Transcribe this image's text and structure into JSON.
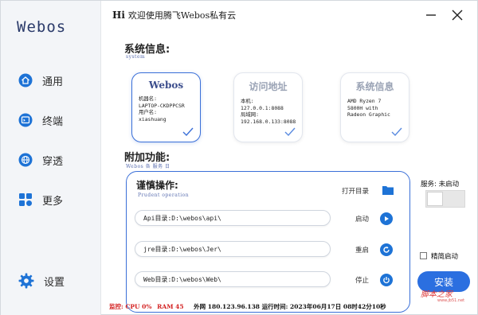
{
  "app": {
    "logo": "Webos"
  },
  "titlebar": {
    "greeting": "Hi",
    "title": "欢迎使用腾飞Webos私有云"
  },
  "sidebar": {
    "items": [
      {
        "label": "通用",
        "icon": "home-icon"
      },
      {
        "label": "终端",
        "icon": "terminal-icon"
      },
      {
        "label": "穿透",
        "icon": "globe-icon"
      },
      {
        "label": "更多",
        "icon": "grid-icon"
      }
    ],
    "settings": {
      "label": "设置",
      "icon": "gear-icon"
    }
  },
  "system": {
    "title": "系统信息:",
    "subtitle": "system",
    "cards": [
      {
        "title": "Webos",
        "body": "机器名:\nLAPTOP-CKDPPCSR\n用户名:\nxiashuang",
        "active": true
      },
      {
        "title": "访问地址",
        "body": "本机:\n127.0.0.1:8088\n局域网:\n192.168.0.133:8088",
        "active": false
      },
      {
        "title": "系统信息",
        "body": "AMD Ryzen 7\n5800H with\nRadeon Graphic",
        "active": false
      }
    ]
  },
  "extra": {
    "title": "附加功能:",
    "subtitle": "Webos 各 服务 日"
  },
  "ops": {
    "title": "谨慎操作:",
    "subtitle": "Prudent operation",
    "open_dir": "打开目录",
    "rows": [
      {
        "path": "Api目录:D:\\webos\\api\\",
        "action": "启动",
        "icon": "play-icon"
      },
      {
        "path": "jre目录:D:\\webos\\Jer\\",
        "action": "重启",
        "icon": "restart-icon"
      },
      {
        "path": "Web目录:D:\\webos\\Web\\",
        "action": "停止",
        "icon": "power-icon"
      }
    ]
  },
  "service": {
    "label": "服务: 未启动"
  },
  "lite_mode": {
    "label": "精简启动",
    "checked": false
  },
  "install": {
    "label": "安装"
  },
  "watermark": {
    "text": "脚本之家",
    "url": "www.jb51.net"
  },
  "status": {
    "monitor_label": "监控:",
    "cpu": "CPU 0%",
    "ram": "RAM 45",
    "network": "外网 180.123.96.138 运行时间: 2023年06月17日 08时42分10秒"
  },
  "colors": {
    "accent": "#2b6fe0",
    "nav_icon": "#1e73d6",
    "alert": "#d32020"
  }
}
